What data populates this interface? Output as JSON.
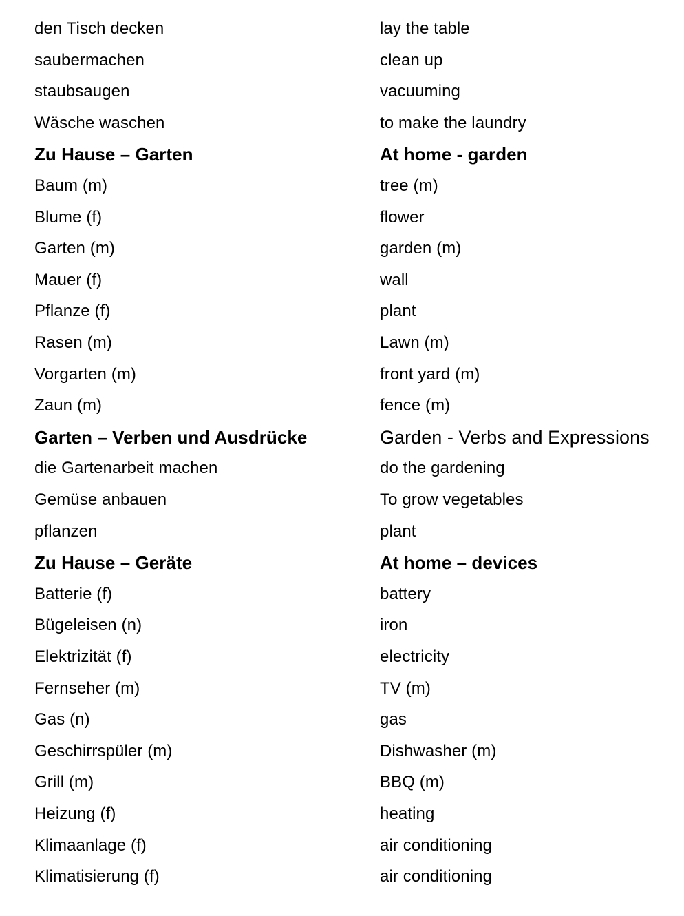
{
  "page": {
    "language_left": "German",
    "language_right": "English"
  },
  "rows": [
    {
      "type": "entry",
      "term": "den Tisch decken",
      "translation": "lay the table"
    },
    {
      "type": "entry",
      "term": "saubermachen",
      "translation": "clean up"
    },
    {
      "type": "entry",
      "term": "staubsaugen",
      "translation": "vacuuming"
    },
    {
      "type": "entry",
      "term": "Wäsche waschen",
      "translation": "to make the laundry"
    },
    {
      "type": "heading",
      "term": "Zu Hause – Garten",
      "translation": "At home - garden"
    },
    {
      "type": "entry",
      "term": "Baum (m)",
      "translation": "tree (m)"
    },
    {
      "type": "entry",
      "term": "Blume (f)",
      "translation": "flower"
    },
    {
      "type": "entry",
      "term": "Garten (m)",
      "translation": "garden (m)"
    },
    {
      "type": "entry",
      "term": "Mauer (f)",
      "translation": "wall"
    },
    {
      "type": "entry",
      "term": "Pflanze (f)",
      "translation": "plant"
    },
    {
      "type": "entry",
      "term": "Rasen (m)",
      "translation": "Lawn (m)"
    },
    {
      "type": "entry",
      "term": "Vorgarten (m)",
      "translation": "front yard (m)"
    },
    {
      "type": "entry",
      "term": "Zaun (m)",
      "translation": "fence (m)"
    },
    {
      "type": "heading",
      "term": "Garten – Verben und Ausdrücke",
      "translation": "Garden - Verbs and Expressions",
      "translation_regular_weight": true
    },
    {
      "type": "entry",
      "term": "die Gartenarbeit machen",
      "translation": "do the gardening"
    },
    {
      "type": "entry",
      "term": "Gemüse anbauen",
      "translation": "To grow vegetables"
    },
    {
      "type": "entry",
      "term": "pflanzen",
      "translation": "plant"
    },
    {
      "type": "heading",
      "term": "Zu Hause – Geräte",
      "translation": "At home – devices"
    },
    {
      "type": "entry",
      "term": "Batterie (f)",
      "translation": "battery"
    },
    {
      "type": "entry",
      "term": "Bügeleisen (n)",
      "translation": "iron"
    },
    {
      "type": "entry",
      "term": "Elektrizität (f)",
      "translation": "electricity"
    },
    {
      "type": "entry",
      "term": "Fernseher (m)",
      "translation": "TV (m)"
    },
    {
      "type": "entry",
      "term": "Gas (n)",
      "translation": "gas"
    },
    {
      "type": "entry",
      "term": "Geschirrspüler (m)",
      "translation": "Dishwasher (m)"
    },
    {
      "type": "entry",
      "term": "Grill (m)",
      "translation": "BBQ (m)"
    },
    {
      "type": "entry",
      "term": "Heizung (f)",
      "translation": "heating"
    },
    {
      "type": "entry",
      "term": "Klimaanlage (f)",
      "translation": "air conditioning"
    },
    {
      "type": "entry",
      "term": "Klimatisierung (f)",
      "translation": "air conditioning"
    }
  ]
}
